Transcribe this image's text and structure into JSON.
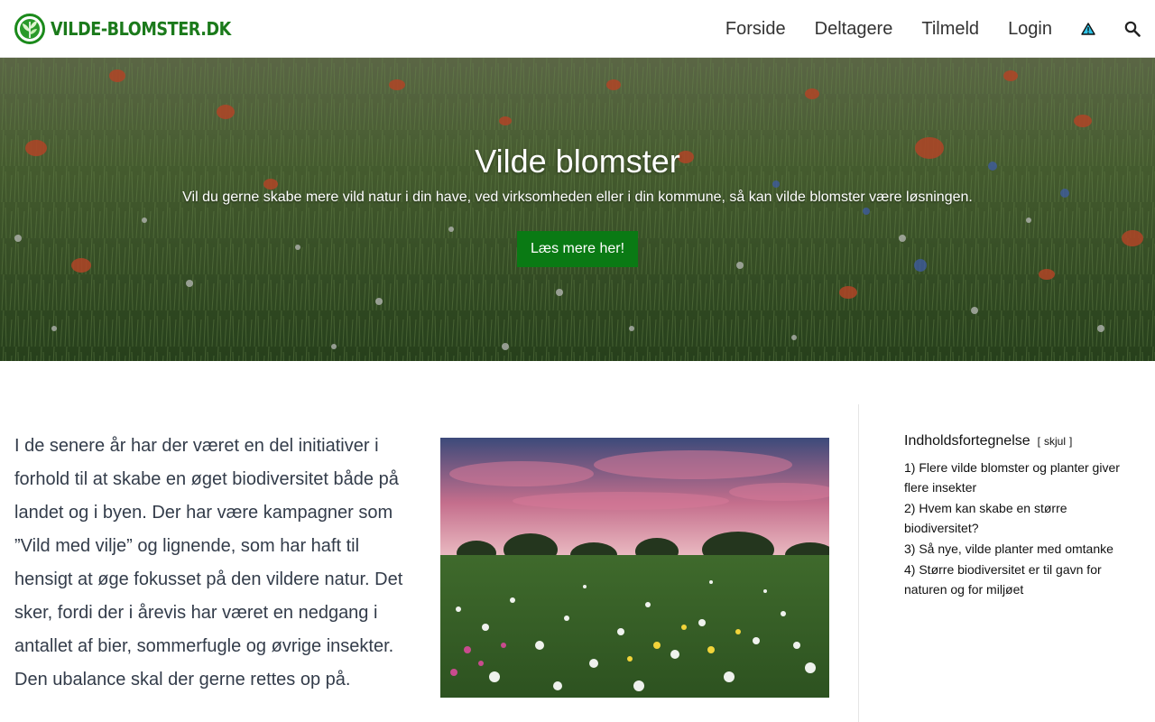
{
  "header": {
    "logo_text": "VILDE-BLOMSTER.DK",
    "nav": [
      {
        "label": "Forside"
      },
      {
        "label": "Deltagere"
      },
      {
        "label": "Tilmeld"
      },
      {
        "label": "Login"
      }
    ],
    "icons": [
      "warning-triangle-icon",
      "search-icon"
    ]
  },
  "hero": {
    "title": "Vilde blomster",
    "subtitle": "Vil du gerne skabe mere vild natur i din have, ved virksomheden eller i din kommune, så kan vilde blomster være løsningen.",
    "button_label": "Læs mere her!"
  },
  "article": {
    "paragraph": "I de senere år har der været en del initiativer i forhold til at skabe en øget biodiversitet både på landet og i byen. Der har være kampagner som ”Vild med vilje” og lignende, som har haft til hensigt at øge fokusset på den vildere natur. Det sker, fordi der i årevis har været en nedgang i antallet af bier, sommerfugle og øvrige insekter. Den ubalance skal der gerne rettes op på."
  },
  "toc": {
    "title": "Indholdsfortegnelse",
    "toggle_open": "[",
    "toggle_label": "skjul",
    "toggle_close": "]",
    "items": [
      {
        "num": "1)",
        "label": "Flere vilde blomster og planter giver flere insekter"
      },
      {
        "num": "2)",
        "label": "Hvem kan skabe en større biodiversitet?"
      },
      {
        "num": "3)",
        "label": "Så nye, vilde planter med omtanke"
      },
      {
        "num": "4)",
        "label": "Større biodiversitet er til gavn for naturen og for miljøet"
      }
    ]
  },
  "colors": {
    "brand_green": "#1b7a1b",
    "button_green": "#0a7a14",
    "warning_fill": "#2ec4e8"
  }
}
